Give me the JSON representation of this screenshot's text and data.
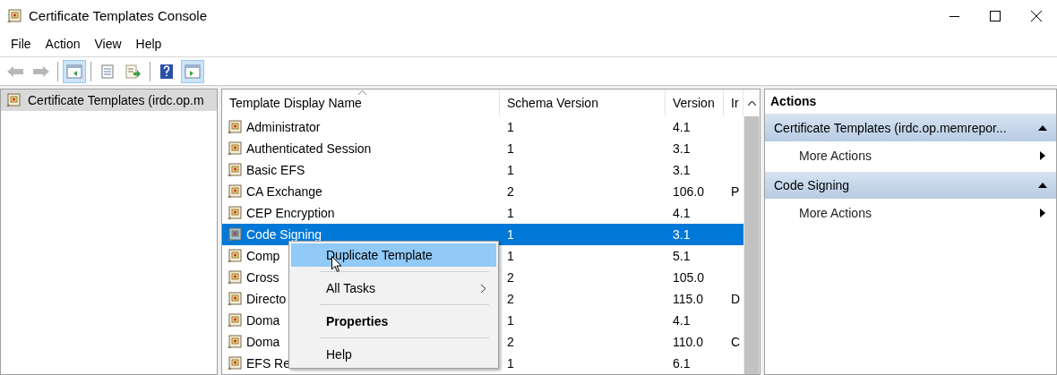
{
  "window": {
    "title": "Certificate Templates Console"
  },
  "menu": [
    "File",
    "Action",
    "View",
    "Help"
  ],
  "toolbar": [
    [
      {
        "kind": "back",
        "pressed": false,
        "disabled": true
      },
      {
        "kind": "forward",
        "pressed": false,
        "disabled": true
      }
    ],
    [
      {
        "kind": "tree",
        "pressed": true,
        "disabled": false
      }
    ],
    [
      {
        "kind": "properties",
        "pressed": false,
        "disabled": false
      },
      {
        "kind": "export",
        "pressed": false,
        "disabled": false
      }
    ],
    [
      {
        "kind": "help",
        "pressed": false,
        "disabled": false
      },
      {
        "kind": "actionpane",
        "pressed": true,
        "disabled": false
      }
    ]
  ],
  "tree": {
    "items": [
      {
        "label": "Certificate Templates (irdc.op.m",
        "selected": true
      }
    ]
  },
  "table": {
    "columns": [
      "Template Display Name",
      "Schema Version",
      "Version",
      "Ir"
    ],
    "rows": [
      {
        "cells": [
          "Administrator",
          "1",
          "4.1",
          ""
        ],
        "selected": false
      },
      {
        "cells": [
          "Authenticated Session",
          "1",
          "3.1",
          ""
        ],
        "selected": false
      },
      {
        "cells": [
          "Basic EFS",
          "1",
          "3.1",
          ""
        ],
        "selected": false
      },
      {
        "cells": [
          "CA Exchange",
          "2",
          "106.0",
          "P"
        ],
        "selected": false
      },
      {
        "cells": [
          "CEP Encryption",
          "1",
          "4.1",
          ""
        ],
        "selected": false
      },
      {
        "cells": [
          "Code Signing",
          "1",
          "3.1",
          ""
        ],
        "selected": true
      },
      {
        "cells": [
          "Comp",
          "1",
          "5.1",
          ""
        ],
        "selected": false
      },
      {
        "cells": [
          "Cross",
          "2",
          "105.0",
          ""
        ],
        "selected": false
      },
      {
        "cells": [
          "Directo",
          "2",
          "115.0",
          "D"
        ],
        "selected": false
      },
      {
        "cells": [
          "Doma",
          "1",
          "4.1",
          ""
        ],
        "selected": false
      },
      {
        "cells": [
          "Doma",
          "2",
          "110.0",
          "C"
        ],
        "selected": false
      },
      {
        "cells": [
          "EFS Re",
          "1",
          "6.1",
          ""
        ],
        "selected": false
      }
    ]
  },
  "context_menu": [
    {
      "label": "Duplicate Template",
      "selected": true,
      "kind": "normal"
    },
    {
      "label": "All Tasks",
      "selected": false,
      "kind": "submenu"
    },
    {
      "label": "Properties",
      "selected": false,
      "kind": "default"
    },
    {
      "label": "Help",
      "selected": false,
      "kind": "normal"
    }
  ],
  "actions": {
    "title": "Actions",
    "groups": [
      {
        "title": "Certificate Templates (irdc.op.memrepor...",
        "expanded": true,
        "items": [
          "More Actions"
        ]
      },
      {
        "title": "Code Signing",
        "expanded": true,
        "items": [
          "More Actions"
        ]
      }
    ]
  }
}
